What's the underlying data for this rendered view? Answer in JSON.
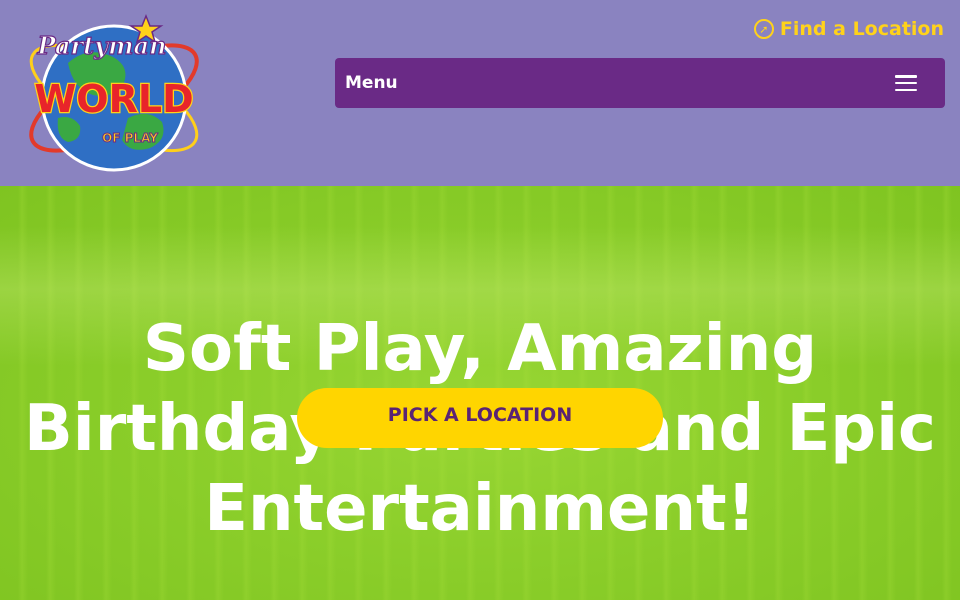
{
  "logo": {
    "brand_script": "Partyman",
    "brand_main": "WORLD",
    "brand_sub": "OF PLAY"
  },
  "header": {
    "find_location_label": "Find a Location",
    "find_location_icon": "compass-icon",
    "menu_label": "Menu",
    "menu_icon": "hamburger-icon"
  },
  "hero": {
    "title": "Soft Play, Amazing Birthday Parties and Epic Entertainment!",
    "cta_label": "PICK A LOCATION"
  },
  "colors": {
    "header_bg": "#8a83c0",
    "menu_bg": "#6a2a86",
    "accent_yellow": "#ffd21a",
    "hero_green": "#8bce2a",
    "cta_text": "#5a2474"
  }
}
